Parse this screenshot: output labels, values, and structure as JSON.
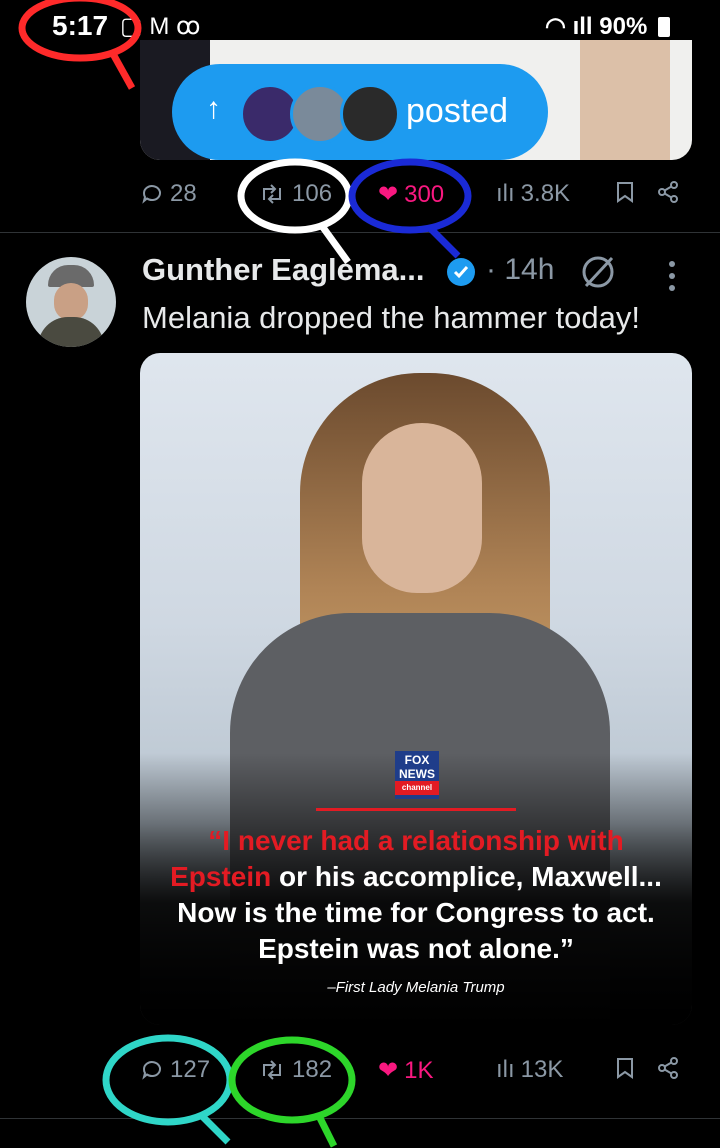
{
  "status_bar": {
    "time": "5:17",
    "battery": "90%"
  },
  "banner": {
    "label": "posted"
  },
  "prev_post": {
    "replies": "28",
    "reposts": "106",
    "likes": "300",
    "views": "3.8K"
  },
  "post": {
    "author": "Gunther Eaglema...",
    "time": "· 14h",
    "text": "Melania dropped the hammer today!",
    "image": {
      "logo_line1": "FOX",
      "logo_line2": "NEWS",
      "logo_line3": "channel",
      "quote_red": "“I never had a relationship with",
      "quote_red2": "Epstein",
      "quote_rest": " or his accomplice, Maxwell...",
      "quote_line3": "Now is the time for Congress to act.",
      "quote_line4": "Epstein was not alone.”",
      "attribution": "–First Lady Melania Trump"
    },
    "replies": "127",
    "reposts": "182",
    "likes": "1K",
    "views": "13K"
  },
  "colors": {
    "accent": "#1d9bf0",
    "like": "#f91880",
    "muted": "#8b98a5"
  }
}
